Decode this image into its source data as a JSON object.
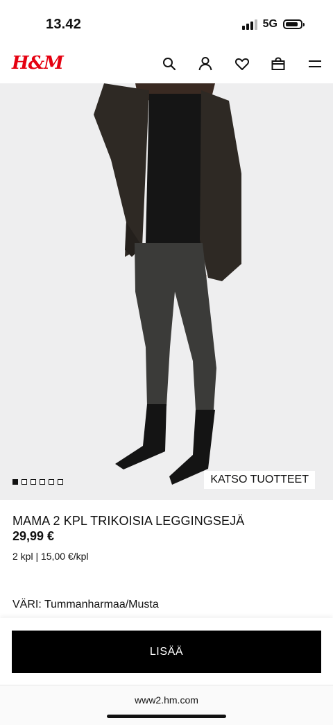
{
  "status": {
    "time": "13.42",
    "network": "5G"
  },
  "header": {
    "logo": "H&M",
    "icons": [
      "search-icon",
      "account-icon",
      "heart-icon",
      "bag-icon",
      "menu-icon"
    ]
  },
  "gallery": {
    "image_count": 6,
    "active_index": 0,
    "view_products_label": "KATSO TUOTTEET"
  },
  "product": {
    "name": "MAMA 2 KPL TRIKOISIA LEGGINGSEJÄ",
    "price": "29,99 €",
    "unit_price": "2 kpl | 15,00 €/kpl",
    "color_label": "VÄRI: Tummanharmaa/Musta"
  },
  "actions": {
    "add_label": "LISÄÄ"
  },
  "browser": {
    "url": "www2.hm.com"
  },
  "colors": {
    "brand": "#e50010",
    "button": "#000000",
    "background": "#eeeeef"
  }
}
